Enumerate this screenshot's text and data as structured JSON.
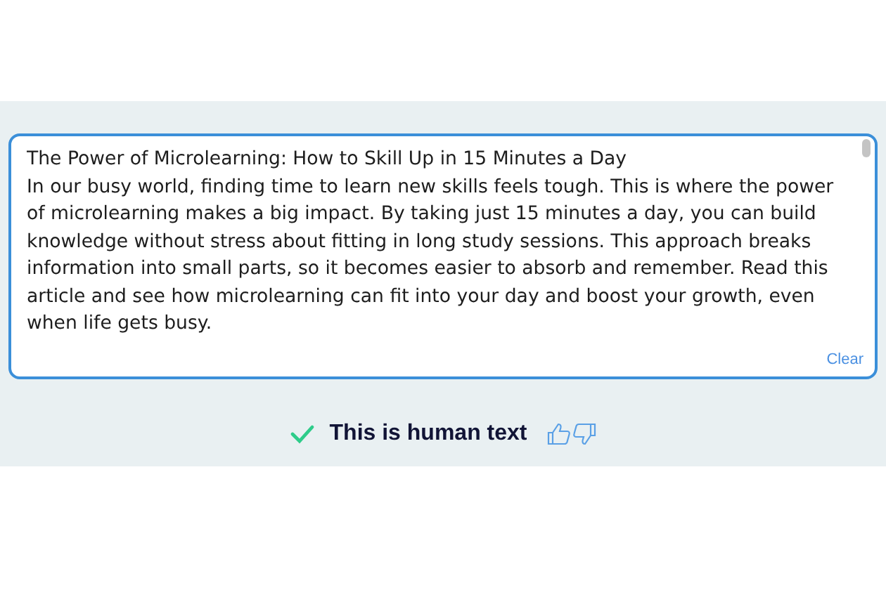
{
  "editor": {
    "title": "The Power of Microlearning: How to Skill Up in 15 Minutes a Day",
    "body": "In our busy world, finding time to learn new skills feels tough. This is where the power of microlearning makes a big impact. By taking just 15 minutes a day, you can build knowledge without stress about fitting in long study sessions. This approach breaks information into small parts, so it becomes easier to absorb and remember.  Read this article and see how microlearning can fit into your day and boost your growth, even when life gets busy.",
    "clear_label": "Clear"
  },
  "result": {
    "is_human": true,
    "label": "This is human text"
  }
}
